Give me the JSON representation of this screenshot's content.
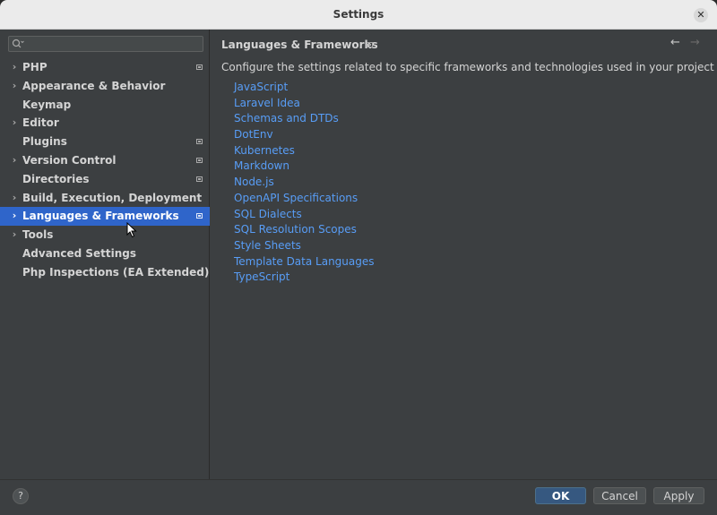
{
  "window": {
    "title": "Settings",
    "close_icon": "close-icon"
  },
  "sidebar": {
    "search": {
      "value": "",
      "placeholder": ""
    },
    "items": [
      {
        "label": "PHP",
        "expandable": true,
        "project_icon": true
      },
      {
        "label": "Appearance & Behavior",
        "expandable": true,
        "project_icon": false
      },
      {
        "label": "Keymap",
        "expandable": false,
        "project_icon": false
      },
      {
        "label": "Editor",
        "expandable": true,
        "project_icon": false
      },
      {
        "label": "Plugins",
        "expandable": false,
        "project_icon": true
      },
      {
        "label": "Version Control",
        "expandable": true,
        "project_icon": true
      },
      {
        "label": "Directories",
        "expandable": false,
        "project_icon": true
      },
      {
        "label": "Build, Execution, Deployment",
        "expandable": true,
        "project_icon": false
      },
      {
        "label": "Languages & Frameworks",
        "expandable": true,
        "project_icon": true,
        "selected": true
      },
      {
        "label": "Tools",
        "expandable": true,
        "project_icon": false
      },
      {
        "label": "Advanced Settings",
        "expandable": false,
        "project_icon": false
      },
      {
        "label": "Php Inspections (EA Extended)",
        "expandable": false,
        "project_icon": false
      }
    ]
  },
  "main": {
    "title": "Languages & Frameworks",
    "description": "Configure the settings related to specific frameworks and technologies used in your project",
    "links": [
      "JavaScript",
      "Laravel Idea",
      "Schemas and DTDs",
      "DotEnv",
      "Kubernetes",
      "Markdown",
      "Node.js",
      "OpenAPI Specifications",
      "SQL Dialects",
      "SQL Resolution Scopes",
      "Style Sheets",
      "Template Data Languages",
      "TypeScript"
    ]
  },
  "footer": {
    "help_label": "?",
    "ok_label": "OK",
    "cancel_label": "Cancel",
    "apply_label": "Apply"
  },
  "colors": {
    "background": "#3c3f41",
    "selection": "#2f65ca",
    "link": "#589df6",
    "ok_button": "#365880"
  }
}
